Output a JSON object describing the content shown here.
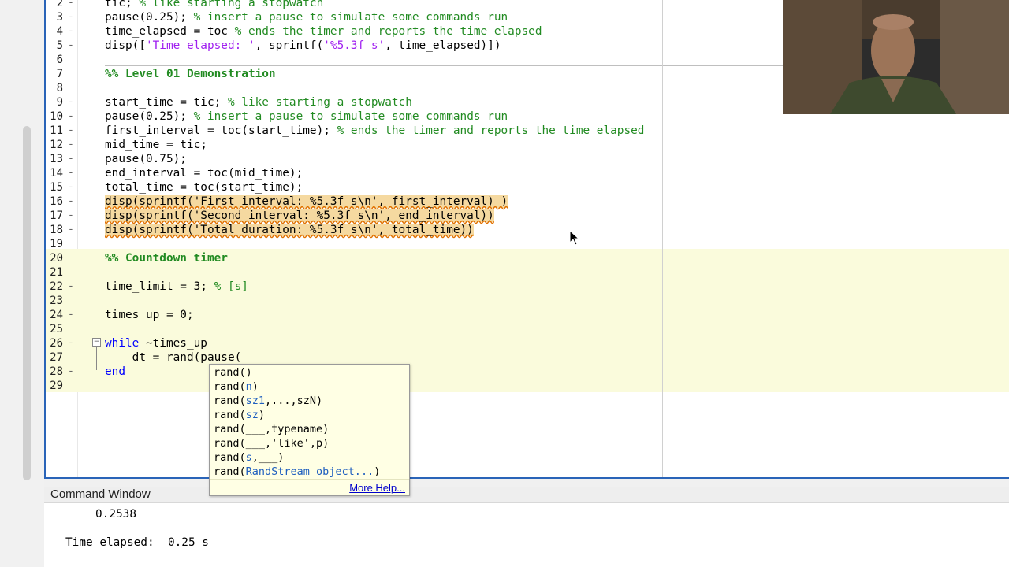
{
  "editor": {
    "lines": [
      {
        "n": "2",
        "marker": "-",
        "segments": [
          {
            "t": "tic; ",
            "c": ""
          },
          {
            "t": "% like starting a stopwatch",
            "c": "cm"
          }
        ]
      },
      {
        "n": "3",
        "marker": "-",
        "segments": [
          {
            "t": "pause(0.25); ",
            "c": ""
          },
          {
            "t": "% insert a pause to simulate some commands run",
            "c": "cm"
          }
        ]
      },
      {
        "n": "4",
        "marker": "-",
        "segments": [
          {
            "t": "time_elapsed = toc ",
            "c": ""
          },
          {
            "t": "% ends the timer and reports the time elapsed",
            "c": "cm"
          }
        ]
      },
      {
        "n": "5",
        "marker": "-",
        "segments": [
          {
            "t": "disp([",
            "c": ""
          },
          {
            "t": "'Time elapsed: '",
            "c": "str"
          },
          {
            "t": ", sprintf(",
            "c": ""
          },
          {
            "t": "'%5.3f s'",
            "c": "str"
          },
          {
            "t": ", time_elapsed)])",
            "c": ""
          }
        ]
      },
      {
        "n": "6",
        "marker": "",
        "segments": []
      },
      {
        "n": "7",
        "marker": "",
        "segments": [
          {
            "t": "%% Level 01 Demonstration",
            "c": "cell"
          }
        ]
      },
      {
        "n": "8",
        "marker": "",
        "segments": []
      },
      {
        "n": "9",
        "marker": "-",
        "segments": [
          {
            "t": "start_time = tic; ",
            "c": ""
          },
          {
            "t": "% like starting a stopwatch",
            "c": "cm"
          }
        ]
      },
      {
        "n": "10",
        "marker": "-",
        "segments": [
          {
            "t": "pause(0.25); ",
            "c": ""
          },
          {
            "t": "% insert a pause to simulate some commands run",
            "c": "cm"
          }
        ]
      },
      {
        "n": "11",
        "marker": "-",
        "segments": [
          {
            "t": "first_interval = toc(start_time); ",
            "c": ""
          },
          {
            "t": "% ends the timer and reports the time elapsed",
            "c": "cm"
          }
        ]
      },
      {
        "n": "12",
        "marker": "-",
        "segments": [
          {
            "t": "mid_time = tic;",
            "c": ""
          }
        ]
      },
      {
        "n": "13",
        "marker": "-",
        "segments": [
          {
            "t": "pause(0.75);",
            "c": ""
          }
        ]
      },
      {
        "n": "14",
        "marker": "-",
        "segments": [
          {
            "t": "end_interval = toc(mid_time);",
            "c": ""
          }
        ]
      },
      {
        "n": "15",
        "marker": "-",
        "segments": [
          {
            "t": "total_time = toc(start_time);",
            "c": ""
          }
        ]
      },
      {
        "n": "16",
        "marker": "-",
        "segments": [
          {
            "t": "disp(sprintf('First interval: %5.3f s\\n', first_interval) )",
            "c": "hl"
          }
        ]
      },
      {
        "n": "17",
        "marker": "-",
        "segments": [
          {
            "t": "disp(sprintf('Second interval: %5.3f s\\n', end_interval))",
            "c": "hl"
          }
        ]
      },
      {
        "n": "18",
        "marker": "-",
        "segments": [
          {
            "t": "disp(sprintf('Total duration: %5.3f s\\n', total_time))",
            "c": "hl"
          }
        ]
      },
      {
        "n": "19",
        "marker": "",
        "segments": []
      },
      {
        "n": "20",
        "marker": "",
        "segments": [
          {
            "t": "%% Countdown timer",
            "c": "cell"
          }
        ]
      },
      {
        "n": "21",
        "marker": "",
        "segments": []
      },
      {
        "n": "22",
        "marker": "-",
        "segments": [
          {
            "t": "time_limit = 3; ",
            "c": ""
          },
          {
            "t": "% [s]",
            "c": "cm"
          }
        ]
      },
      {
        "n": "23",
        "marker": "",
        "segments": []
      },
      {
        "n": "24",
        "marker": "-",
        "segments": [
          {
            "t": "times_up = 0;",
            "c": ""
          }
        ]
      },
      {
        "n": "25",
        "marker": "",
        "segments": []
      },
      {
        "n": "26",
        "marker": "-",
        "segments": [
          {
            "t": "while",
            "c": "kw"
          },
          {
            "t": " ~times_up",
            "c": ""
          }
        ]
      },
      {
        "n": "27",
        "marker": "",
        "segments": [
          {
            "t": "    dt = rand(pause(",
            "c": ""
          }
        ]
      },
      {
        "n": "28",
        "marker": "-",
        "segments": [
          {
            "t": "end",
            "c": "kw"
          }
        ]
      },
      {
        "n": "29",
        "marker": "",
        "segments": []
      }
    ]
  },
  "autocomplete": {
    "items": [
      [
        {
          "t": "rand()",
          "c": ""
        }
      ],
      [
        {
          "t": "rand(",
          "c": ""
        },
        {
          "t": "n",
          "c": "arg"
        },
        {
          "t": ")",
          "c": ""
        }
      ],
      [
        {
          "t": "rand(",
          "c": ""
        },
        {
          "t": "sz1",
          "c": "arg"
        },
        {
          "t": ",...,szN)",
          "c": ""
        }
      ],
      [
        {
          "t": "rand(",
          "c": ""
        },
        {
          "t": "sz",
          "c": "arg"
        },
        {
          "t": ")",
          "c": ""
        }
      ],
      [
        {
          "t": "rand(___,typename)",
          "c": ""
        }
      ],
      [
        {
          "t": "rand(___,'like',p)",
          "c": ""
        }
      ],
      [
        {
          "t": "rand(",
          "c": ""
        },
        {
          "t": "s",
          "c": "arg"
        },
        {
          "t": ",___)",
          "c": ""
        }
      ],
      [
        {
          "t": "rand(",
          "c": ""
        },
        {
          "t": "RandStream object...",
          "c": "arg"
        },
        {
          "t": ")",
          "c": ""
        }
      ]
    ],
    "more_help": "More Help..."
  },
  "command_window": {
    "title": "Command Window",
    "lines": [
      "0.2538",
      "Time elapsed:  0.25 s"
    ]
  },
  "colors": {
    "comment": "#228b22",
    "string": "#a020f0",
    "keyword": "#0000ff",
    "accent": "#2a64b8",
    "cell_band": "#fafbdc"
  }
}
